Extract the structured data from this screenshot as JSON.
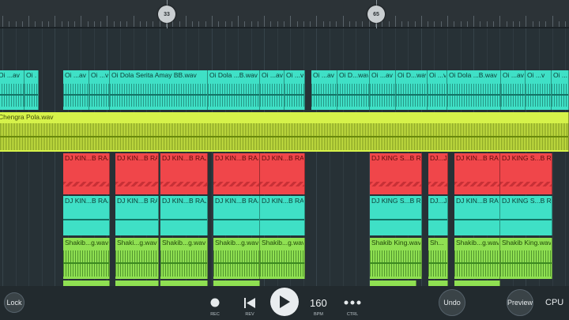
{
  "ruler": {
    "markers": [
      "33",
      "65"
    ]
  },
  "tracks": {
    "row1": [
      {
        "label": "Oi ...av"
      },
      {
        "label": "Oi ...v"
      },
      {
        "label": "Oi ...av"
      },
      {
        "label": "Oi ...v"
      },
      {
        "label": "Oi Dola Serita Amay BB.wav"
      },
      {
        "label": "Oi Dola ...B.wav"
      },
      {
        "label": "Oi ...av"
      },
      {
        "label": "Oi ...v"
      },
      {
        "label": "Oi ...av"
      },
      {
        "label": "Oi D...wav"
      },
      {
        "label": "Oi ...av"
      },
      {
        "label": "Oi D...wav"
      },
      {
        "label": "Oi ...v"
      },
      {
        "label": "Oi Dola ...B.wav"
      },
      {
        "label": "Oi ...av"
      },
      {
        "label": "Oi ...v"
      },
      {
        "label": "Oi ..."
      }
    ],
    "row2": [
      {
        "label": "Chengra Pola.wav"
      }
    ],
    "row3": [
      {
        "label": "DJ KIN...B RAJ"
      },
      {
        "label": "DJ KIN...B RAJ"
      },
      {
        "label": "DJ KIN...B RAJ"
      },
      {
        "label": "DJ KIN...B RAJ"
      },
      {
        "label": "DJ KIN...B RAJ"
      },
      {
        "label": "DJ KING S...B RAJ"
      },
      {
        "label": "DJ...J"
      },
      {
        "label": "DJ KIN...B RAJ"
      },
      {
        "label": "DJ KING S...B RAJ"
      }
    ],
    "row4": [
      {
        "label": "DJ KIN...B RAJ"
      },
      {
        "label": "DJ KIN...B RAJ"
      },
      {
        "label": "DJ KIN...B RAJ"
      },
      {
        "label": "DJ KIN...B RAJ"
      },
      {
        "label": "DJ KIN...B RAJ"
      },
      {
        "label": "DJ KING S...B RAJ"
      },
      {
        "label": "DJ...J"
      },
      {
        "label": "DJ KIN...B RAJ"
      },
      {
        "label": "DJ KING S...B RAJ"
      }
    ],
    "row5": [
      {
        "label": "Shakib...g.wav"
      },
      {
        "label": "Shaki...g.wav"
      },
      {
        "label": "Shakib...g.wav"
      },
      {
        "label": "Shakib...g.wav"
      },
      {
        "label": "Shakib...g.wav"
      },
      {
        "label": "Shakib King.wav"
      },
      {
        "label": "Sh..."
      },
      {
        "label": "Shakib...g.wav"
      },
      {
        "label": "Shakib King.wav"
      }
    ]
  },
  "transport": {
    "lock_label": "Lock",
    "rec_label": "REC",
    "rev_label": "REV",
    "bpm_value": "160",
    "bpm_label": "BPM",
    "ctrl_label": "CTRL",
    "undo_label": "Undo",
    "preview_label": "Preview",
    "cpu_label": "CPU"
  },
  "colors": {
    "background": "#273136",
    "clip_cyan": "#3fe0c6",
    "clip_yellow": "#d6f24a",
    "clip_red": "#f0464a",
    "clip_green": "#8fe052"
  }
}
